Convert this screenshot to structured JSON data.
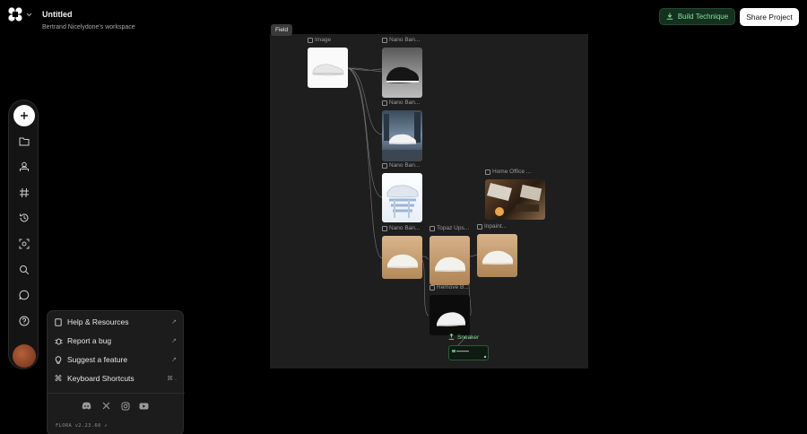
{
  "header": {
    "title": "Untitled",
    "workspace": "Bertrand Nicelydone's workspace",
    "build_label": "Build Technique",
    "share_label": "Share Project"
  },
  "toolbar": {
    "icons": [
      "add-icon",
      "folder-icon",
      "user-upload-icon",
      "hashtag-icon",
      "history-icon",
      "scan-icon",
      "search-icon",
      "chat-icon",
      "help-icon"
    ]
  },
  "help_menu": {
    "items": [
      {
        "label": "Help & Resources",
        "icon": "book-icon",
        "trail": "↗"
      },
      {
        "label": "Report a bug",
        "icon": "bug-icon",
        "trail": "↗"
      },
      {
        "label": "Suggest a feature",
        "icon": "bulb-icon",
        "trail": "↗"
      },
      {
        "label": "Keyboard Shortcuts",
        "icon": "command-icon",
        "trail": "⌘ ."
      }
    ],
    "social": [
      "discord-icon",
      "x-icon",
      "instagram-icon",
      "youtube-icon"
    ],
    "version": "FLORA v2.23.60 ↗"
  },
  "canvas": {
    "frame_label": "Field",
    "nodes": [
      {
        "label": "Image"
      },
      {
        "label": "Nano Ban..."
      },
      {
        "label": "Nano Ban..."
      },
      {
        "label": "Nano Ban..."
      },
      {
        "label": "Nano Ban..."
      },
      {
        "label": "Topaz Ups..."
      },
      {
        "label": "Inpaint..."
      },
      {
        "label": "Home Office ..."
      },
      {
        "label": "Remove B..."
      }
    ],
    "sneaker_label": "Sneaker"
  },
  "colors": {
    "accent_green": "#7fe19c",
    "build_bg": "#15301f",
    "frame_bg": "#1e1e1e"
  }
}
